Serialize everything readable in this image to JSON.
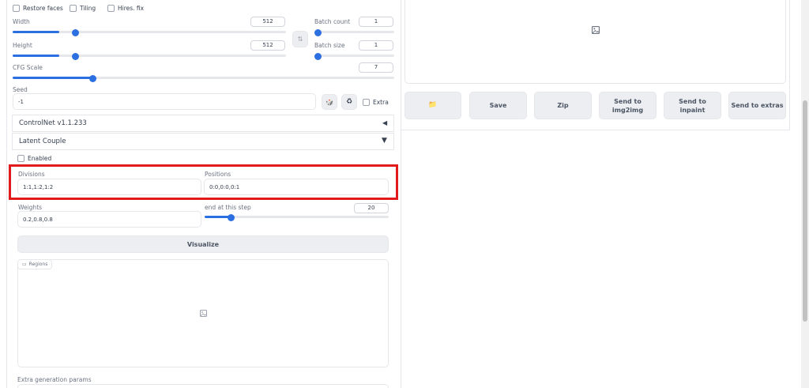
{
  "top_checks": {
    "restore_faces": "Restore faces",
    "tiling": "Tiling",
    "hires_fix": "Hires. fix"
  },
  "width": {
    "label": "Width",
    "value": "512"
  },
  "height": {
    "label": "Height",
    "value": "512"
  },
  "batch_count": {
    "label": "Batch count",
    "value": "1"
  },
  "batch_size": {
    "label": "Batch size",
    "value": "1"
  },
  "cfg": {
    "label": "CFG Scale",
    "value": "7"
  },
  "seed": {
    "label": "Seed",
    "value": "-1",
    "extra_label": "Extra"
  },
  "controlnet": {
    "title": "ControlNet v1.1.233",
    "arrow": "◀"
  },
  "latent_couple": {
    "title": "Latent Couple",
    "arrow": "▼",
    "enabled_label": "Enabled",
    "divisions_label": "Divisions",
    "divisions_value": "1:1,1:2,1:2",
    "positions_label": "Positions",
    "positions_value": "0:0,0:0,0:1",
    "weights_label": "Weights",
    "weights_value": "0.2,0.8,0.8",
    "step_label": "end at this step",
    "step_value": "20",
    "visualize_label": "Visualize",
    "regions_label": "Regions"
  },
  "extra_params_label": "Extra generation params",
  "output_buttons": {
    "folder_icon": "📁",
    "save": "Save",
    "zip": "Zip",
    "img2img": "Send to\nimg2img",
    "inpaint": "Send to\ninpaint",
    "extras": "Send to extras"
  },
  "slider_levels": {
    "width": 0.17,
    "height": 0.17,
    "cfg": 0.21,
    "batch_count": 0.0,
    "batch_size": 0.0,
    "step": 0.2
  },
  "colors": {
    "accent": "#2b6fe0",
    "highlight": "#e11b1b"
  }
}
